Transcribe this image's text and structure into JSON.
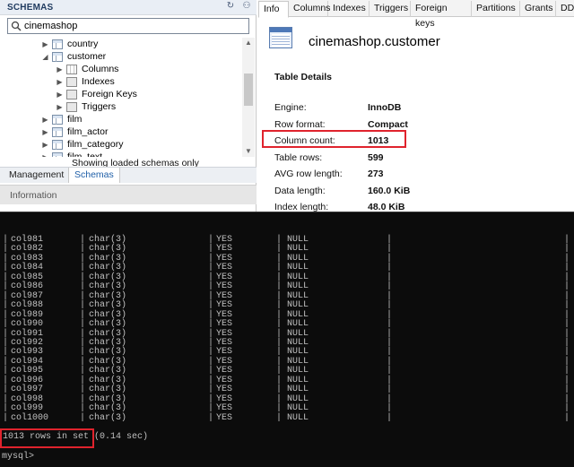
{
  "navigator": {
    "title": "SCHEMAS",
    "search_value": "cinemashop",
    "tree": [
      {
        "label": "country",
        "level": 1,
        "expanded": false,
        "icon": "table-icon"
      },
      {
        "label": "customer",
        "level": 1,
        "expanded": true,
        "icon": "table-icon"
      },
      {
        "label": "Columns",
        "level": 2,
        "expanded": false,
        "icon": "columns-icon"
      },
      {
        "label": "Indexes",
        "level": 2,
        "expanded": false,
        "icon": "folder-icon"
      },
      {
        "label": "Foreign Keys",
        "level": 2,
        "expanded": false,
        "icon": "folder-icon"
      },
      {
        "label": "Triggers",
        "level": 2,
        "expanded": false,
        "icon": "folder-icon"
      },
      {
        "label": "film",
        "level": 1,
        "expanded": false,
        "icon": "table-icon"
      },
      {
        "label": "film_actor",
        "level": 1,
        "expanded": false,
        "icon": "table-icon"
      },
      {
        "label": "film_category",
        "level": 1,
        "expanded": false,
        "icon": "table-icon"
      },
      {
        "label": "film_text",
        "level": 1,
        "expanded": false,
        "icon": "table-icon"
      }
    ],
    "loading_message": "Showing loaded schemas only",
    "tabs": {
      "management": "Management",
      "schemas": "Schemas"
    },
    "info_label": "Information"
  },
  "inspector": {
    "tabs": [
      "Info",
      "Columns",
      "Indexes",
      "Triggers",
      "Foreign keys",
      "Partitions",
      "Grants",
      "DDL"
    ],
    "object_title": "cinemashop.customer",
    "section_title": "Table Details",
    "details": [
      {
        "key": "Engine:",
        "value": "InnoDB"
      },
      {
        "key": "Row format:",
        "value": "Compact"
      },
      {
        "key": "Column count:",
        "value": "1013"
      },
      {
        "key": "Table rows:",
        "value": "599"
      },
      {
        "key": "AVG row length:",
        "value": "273"
      },
      {
        "key": "Data length:",
        "value": "160.0 KiB"
      },
      {
        "key": "Index length:",
        "value": "48.0 KiB"
      }
    ]
  },
  "console": {
    "rows": [
      {
        "field": "col981",
        "type": "char(3)",
        "null": "YES",
        "default": "NULL"
      },
      {
        "field": "col982",
        "type": "char(3)",
        "null": "YES",
        "default": "NULL"
      },
      {
        "field": "col983",
        "type": "char(3)",
        "null": "YES",
        "default": "NULL"
      },
      {
        "field": "col984",
        "type": "char(3)",
        "null": "YES",
        "default": "NULL"
      },
      {
        "field": "col985",
        "type": "char(3)",
        "null": "YES",
        "default": "NULL"
      },
      {
        "field": "col986",
        "type": "char(3)",
        "null": "YES",
        "default": "NULL"
      },
      {
        "field": "col987",
        "type": "char(3)",
        "null": "YES",
        "default": "NULL"
      },
      {
        "field": "col988",
        "type": "char(3)",
        "null": "YES",
        "default": "NULL"
      },
      {
        "field": "col989",
        "type": "char(3)",
        "null": "YES",
        "default": "NULL"
      },
      {
        "field": "col990",
        "type": "char(3)",
        "null": "YES",
        "default": "NULL"
      },
      {
        "field": "col991",
        "type": "char(3)",
        "null": "YES",
        "default": "NULL"
      },
      {
        "field": "col992",
        "type": "char(3)",
        "null": "YES",
        "default": "NULL"
      },
      {
        "field": "col993",
        "type": "char(3)",
        "null": "YES",
        "default": "NULL"
      },
      {
        "field": "col994",
        "type": "char(3)",
        "null": "YES",
        "default": "NULL"
      },
      {
        "field": "col995",
        "type": "char(3)",
        "null": "YES",
        "default": "NULL"
      },
      {
        "field": "col996",
        "type": "char(3)",
        "null": "YES",
        "default": "NULL"
      },
      {
        "field": "col997",
        "type": "char(3)",
        "null": "YES",
        "default": "NULL"
      },
      {
        "field": "col998",
        "type": "char(3)",
        "null": "YES",
        "default": "NULL"
      },
      {
        "field": "col999",
        "type": "char(3)",
        "null": "YES",
        "default": "NULL"
      },
      {
        "field": "col1000",
        "type": "char(3)",
        "null": "YES",
        "default": "NULL"
      }
    ],
    "result_text": "1013 rows in set (0.14 sec)",
    "prompt": "mysql>"
  },
  "colors": {
    "highlight": "#e0232d",
    "console_bg": "#0c0c0c",
    "console_text": "#c0c0c0",
    "active_tab_text": "#1f5fa8"
  }
}
